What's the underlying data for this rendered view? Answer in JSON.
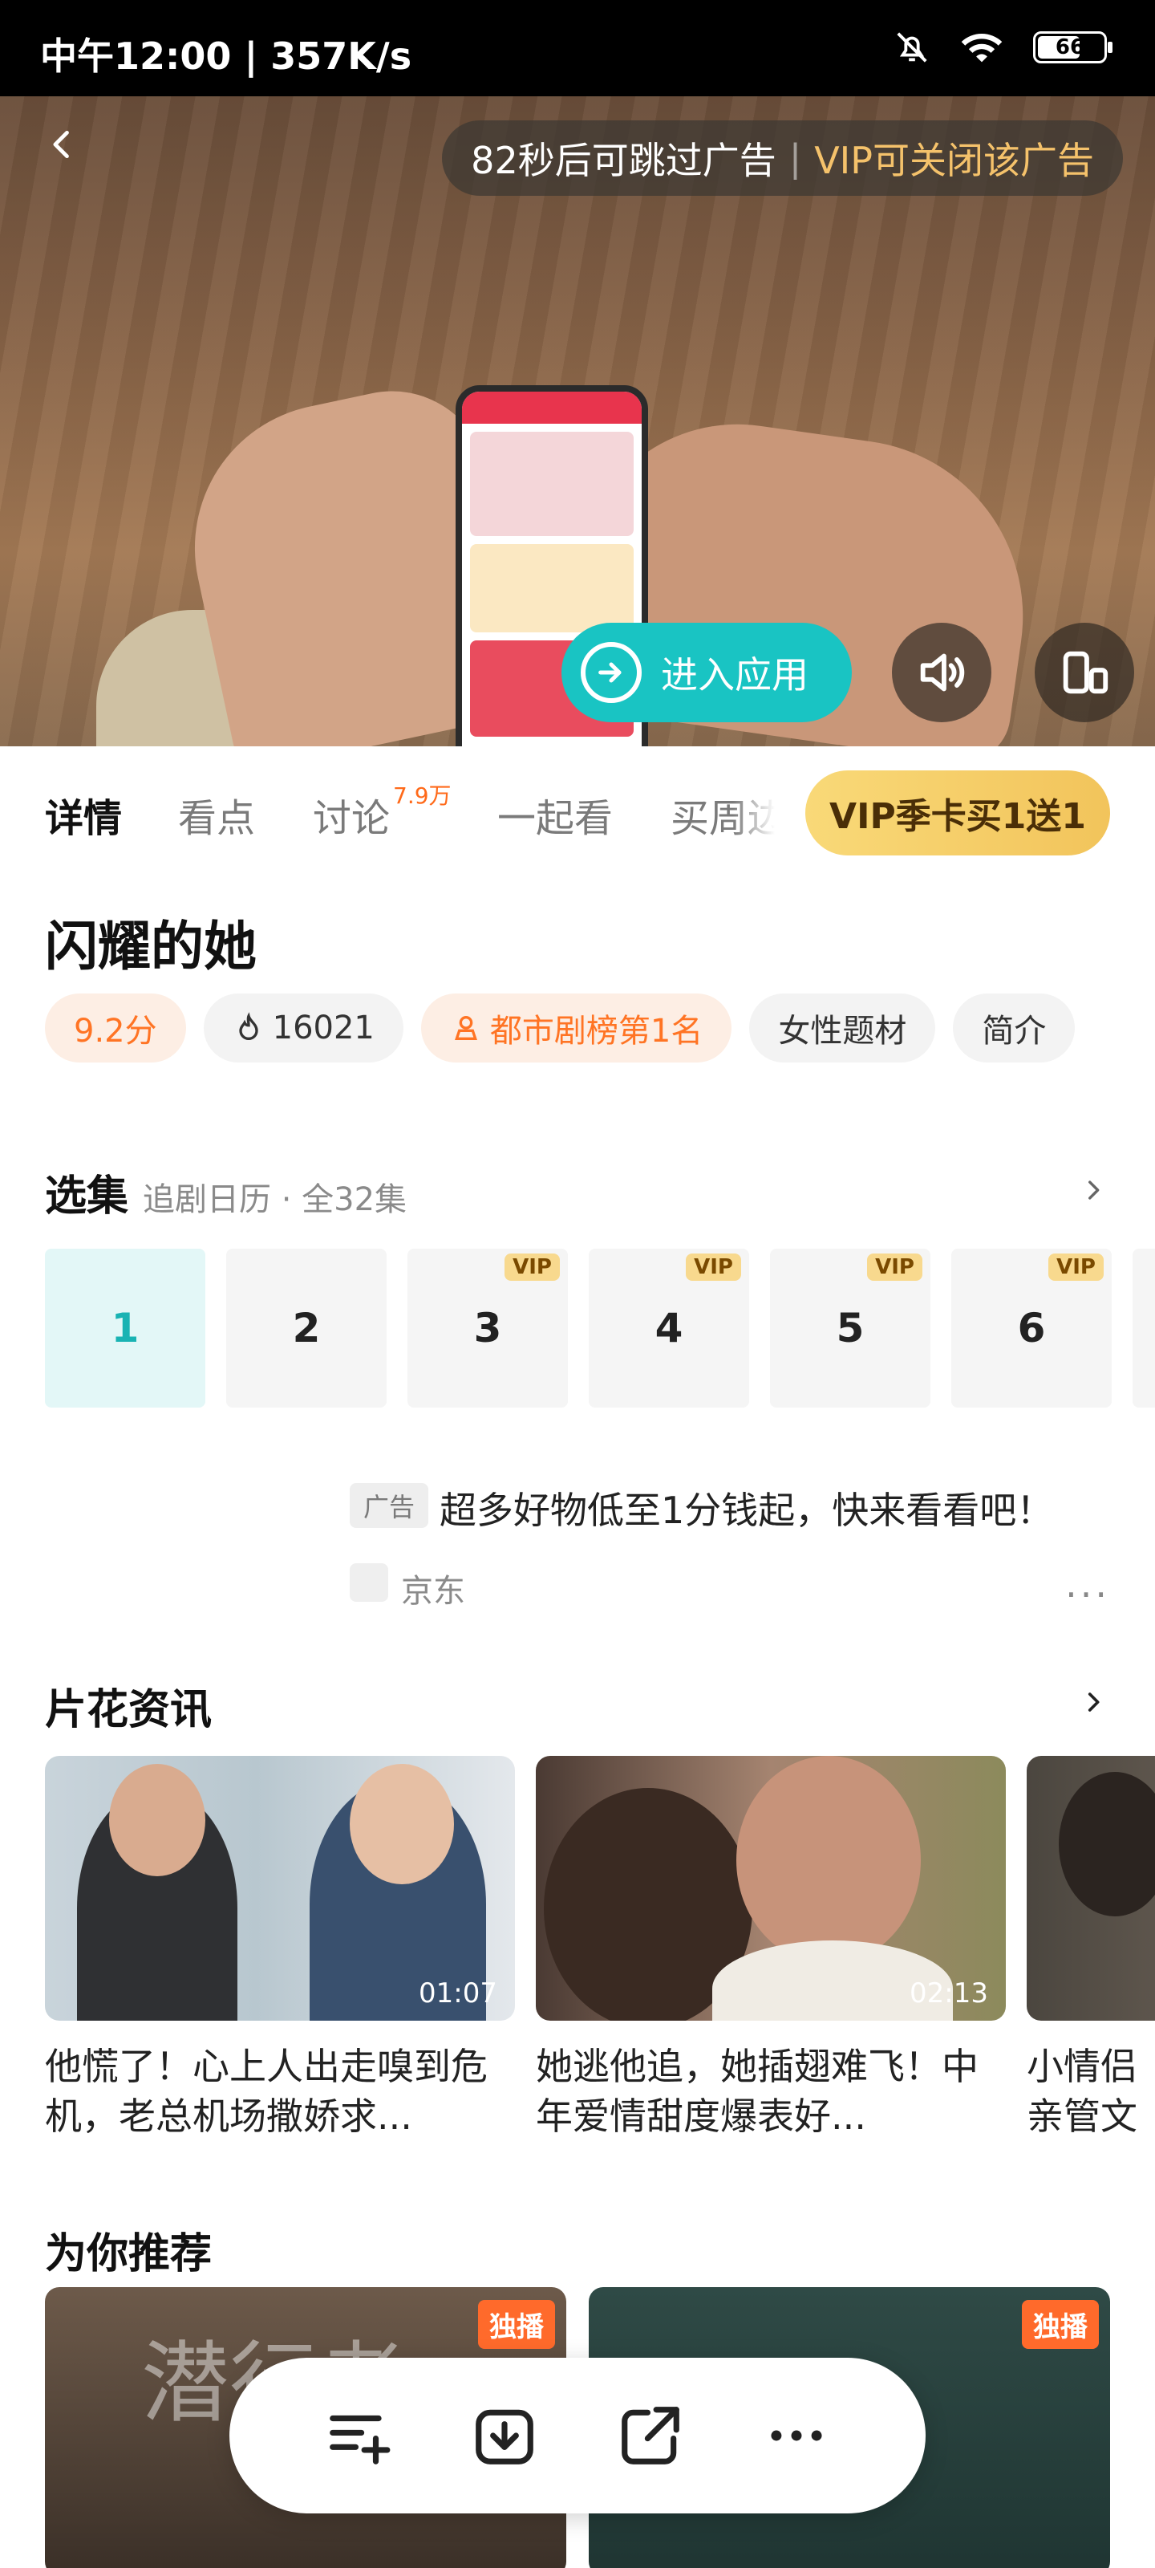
{
  "status_bar": {
    "time": "中午12:00 | 357K/s",
    "battery": "66"
  },
  "video": {
    "skip_text": "82秒后可跳过广告",
    "vip_close_text": "VIP可关闭该广告",
    "enter_app_label": "进入应用"
  },
  "tabs": [
    {
      "label": "详情"
    },
    {
      "label": "看点"
    },
    {
      "label": "讨论",
      "badge": "7.9万"
    },
    {
      "label": "一起看"
    },
    {
      "label": "买周边"
    }
  ],
  "vip_button": "VIP季卡买1送1",
  "show": {
    "title": "闪耀的她",
    "score": "9.2分",
    "heat": "16021",
    "rank": "都市剧榜第1名",
    "genre": "女性题材",
    "intro": "简介"
  },
  "episodes": {
    "heading": "选集",
    "subtitle": "追剧日历 · 全32集",
    "vip_label": "VIP",
    "items": [
      {
        "num": "1",
        "vip": false
      },
      {
        "num": "2",
        "vip": false
      },
      {
        "num": "3",
        "vip": true
      },
      {
        "num": "4",
        "vip": true
      },
      {
        "num": "5",
        "vip": true
      },
      {
        "num": "6",
        "vip": true
      }
    ]
  },
  "ad": {
    "badge": "广告",
    "text": "超多好物低至1分钱起，快来看看吧！",
    "source": "京东",
    "more": "···"
  },
  "clips": {
    "heading": "片花资讯",
    "items": [
      {
        "duration": "01:07",
        "caption": "他慌了！心上人出走嗅到危机，老总机场撒娇求..."
      },
      {
        "duration": "02:13",
        "caption": "她逃他追，她插翅难飞！中年爱情甜度爆表好..."
      },
      {
        "duration": "",
        "caption": "小情侣亲管文躲藏"
      }
    ]
  },
  "recommend": {
    "heading": "为你推荐",
    "exclusive_tag": "独播",
    "poster1_text": "潜行者"
  },
  "colors": {
    "accent": "#19c4c3",
    "orange": "#ff7424",
    "vip_gold": "#f2c45b"
  }
}
